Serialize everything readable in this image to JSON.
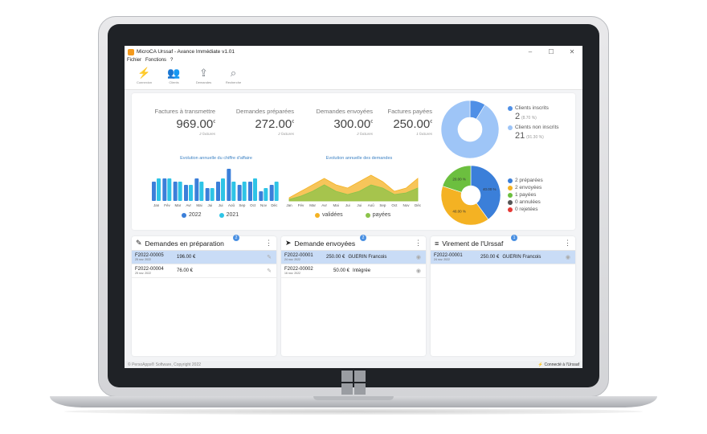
{
  "window": {
    "title": "MicroCA Urssaf - Avance Immédiate v1.01"
  },
  "menu": [
    "Fichier",
    "Fonctions",
    "?"
  ],
  "toolbar": [
    {
      "label": "Connexion",
      "icon": "plug-icon"
    },
    {
      "label": "Clients",
      "icon": "users-icon"
    },
    {
      "label": "Demandes",
      "icon": "upload-icon"
    },
    {
      "label": "Recherche",
      "icon": "search-icon"
    }
  ],
  "stats": [
    {
      "title": "Factures à transmettre",
      "value": "969.00",
      "currency": "€",
      "sub": "2 factures"
    },
    {
      "title": "Demandes préparées",
      "value": "272.00",
      "currency": "€",
      "sub": "2 factures"
    },
    {
      "title": "Demandes envoyées",
      "value": "300.00",
      "currency": "€",
      "sub": "2 factures"
    },
    {
      "title": "Factures payées",
      "value": "250.00",
      "currency": "€",
      "sub": "1 factures"
    }
  ],
  "chart_data": [
    {
      "type": "bar",
      "title": "Evolution annuelle du chiffre d'affaire",
      "categories": [
        "Jan",
        "Fév",
        "Mar",
        "Avr",
        "Mai",
        "Jui",
        "Jui",
        "Aoû",
        "Sep",
        "Oct",
        "Nov",
        "Déc"
      ],
      "series": [
        {
          "name": "2022",
          "color": "#3b7fd9",
          "values": [
            6,
            7,
            6,
            5,
            7,
            4,
            6,
            10,
            5,
            6,
            3,
            5
          ]
        },
        {
          "name": "2021",
          "color": "#2ec4e6",
          "values": [
            7,
            7,
            6,
            5,
            6,
            4,
            7,
            6,
            6,
            7,
            4,
            6
          ]
        }
      ],
      "ymax": 10
    },
    {
      "type": "area",
      "title": "Evolution annuelle des demandes",
      "categories": [
        "Jan",
        "Fév",
        "Mar",
        "Avr",
        "Mai",
        "Jui",
        "Jui",
        "Aoû",
        "Sep",
        "Oct",
        "Nov",
        "Déc"
      ],
      "series": [
        {
          "name": "validées",
          "color": "#f4b223",
          "values": [
            1,
            3,
            5,
            7,
            5,
            4,
            6,
            8,
            6,
            3,
            4,
            7
          ]
        },
        {
          "name": "payées",
          "color": "#8bc34a",
          "values": [
            0.5,
            1.5,
            3,
            5,
            3,
            2,
            3,
            5,
            4,
            2,
            2.5,
            4
          ]
        }
      ],
      "ymax": 10
    },
    {
      "type": "pie",
      "slices": [
        {
          "label": "Clients inscrits",
          "value": 8.7,
          "color": "#4f8fe6"
        },
        {
          "label": "Clients non inscrits",
          "value": 91.3,
          "color": "#9ec5f7"
        }
      ]
    },
    {
      "type": "pie",
      "slices": [
        {
          "label": "préparées",
          "value": 40,
          "color": "#3b7fd9"
        },
        {
          "label": "envoyées",
          "value": 40,
          "color": "#f4b223"
        },
        {
          "label": "payées",
          "value": 20,
          "color": "#6cbf3f"
        },
        {
          "label": "annulées",
          "value": 0,
          "color": "#555555"
        },
        {
          "label": "rejetées",
          "value": 0,
          "color": "#e53935"
        }
      ]
    }
  ],
  "clients": {
    "inscrits_label": "Clients inscrits",
    "inscrits_count": "2",
    "inscrits_pct": "(8.70 %)",
    "non_label": "Clients non inscrits",
    "non_count": "21",
    "non_pct": "(91.30 %)"
  },
  "demandes_legend": [
    "2 préparées",
    "2 envoyées",
    "1 payées",
    "0 annulées",
    "0 rejetées"
  ],
  "donut_labels": [
    "40.00 %",
    "40.00 %",
    "20.00 %"
  ],
  "panels": [
    {
      "title": "Demandes en préparation",
      "badge": "2",
      "icon": "pencil-icon",
      "rows": [
        {
          "id": "F2022-00005",
          "date": "25 nov. 2022",
          "amount": "196.00 €",
          "who": "",
          "action": "edit-icon",
          "selected": true
        },
        {
          "id": "F2022-00004",
          "date": "25 nov. 2022",
          "amount": "76.00 €",
          "who": "",
          "action": "edit-icon",
          "selected": false
        }
      ]
    },
    {
      "title": "Demande envoyées",
      "badge": "2",
      "icon": "send-icon",
      "rows": [
        {
          "id": "F2022-00001",
          "date": "24 nov. 2022",
          "amount": "250.00 €",
          "who": "GUERIN Francois",
          "action": "eye-icon",
          "selected": true
        },
        {
          "id": "F2022-00002",
          "date": "16 nov. 2022",
          "amount": "50.00 €",
          "who": "Intégrée",
          "action": "eye-icon",
          "selected": false
        }
      ]
    },
    {
      "title": "Virement de l'Urssaf",
      "badge": "1",
      "icon": "coins-icon",
      "rows": [
        {
          "id": "F2022-00001",
          "date": "24 nov. 2022",
          "amount": "250.00 €",
          "who": "GUERIN Francois",
          "action": "eye-icon",
          "selected": true
        }
      ]
    }
  ],
  "status": {
    "copyright": "© PersoApps® Software, Copyright 2022",
    "connection": "Connecté à l'Urssaf"
  }
}
